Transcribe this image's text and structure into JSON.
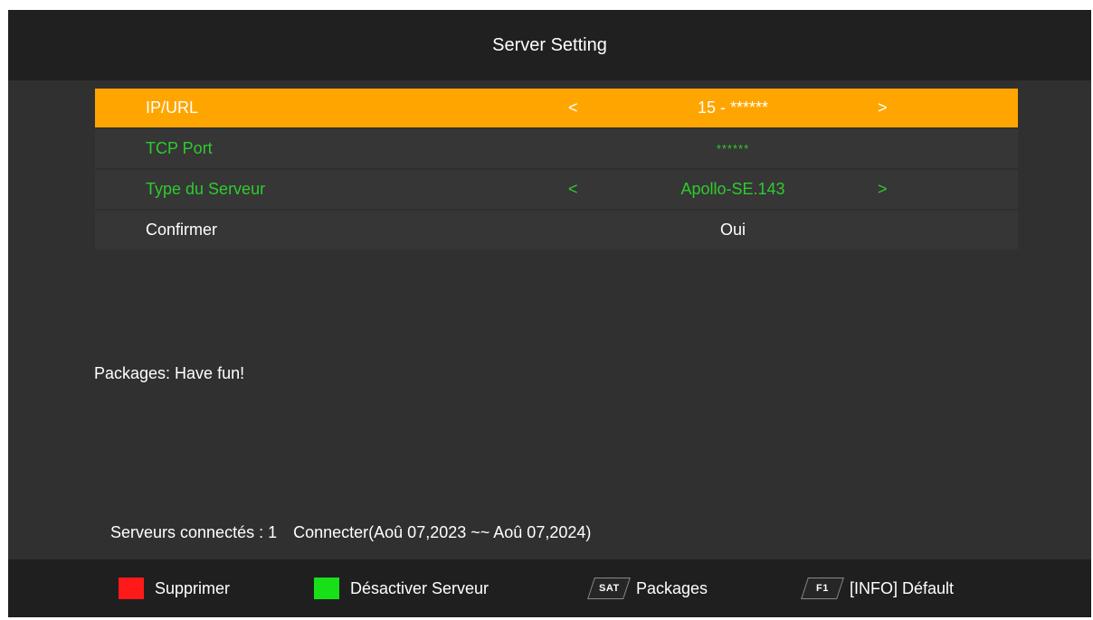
{
  "header": {
    "title": "Server Setting"
  },
  "menu": {
    "rows": [
      {
        "label": "IP/URL",
        "value": "15 - ******",
        "left_arrow": "<",
        "right_arrow": ">"
      },
      {
        "label": "TCP Port",
        "value": "******"
      },
      {
        "label": "Type du Serveur",
        "value": "Apollo-SE.143",
        "left_arrow": "<",
        "right_arrow": ">"
      },
      {
        "label": "Confirmer",
        "value": "Oui"
      }
    ]
  },
  "info": {
    "text": "Packages: Have fun!"
  },
  "status": {
    "connected": "Serveurs connectés : 1",
    "period": "Connecter(Aoû 07,2023 ~~ Aoû 07,2024)"
  },
  "footer": {
    "items": [
      {
        "label": "Supprimer",
        "color": "#ff1a1a"
      },
      {
        "label": "Désactiver Serveur",
        "color": "#18e018"
      },
      {
        "key": "SAT",
        "label": "Packages"
      },
      {
        "key": "F1",
        "label": "[INFO] Défault"
      }
    ]
  },
  "colors": {
    "highlight": "#FFA500",
    "active_text": "#2ecb2e",
    "background": "#303030",
    "header_bg": "#202020"
  }
}
